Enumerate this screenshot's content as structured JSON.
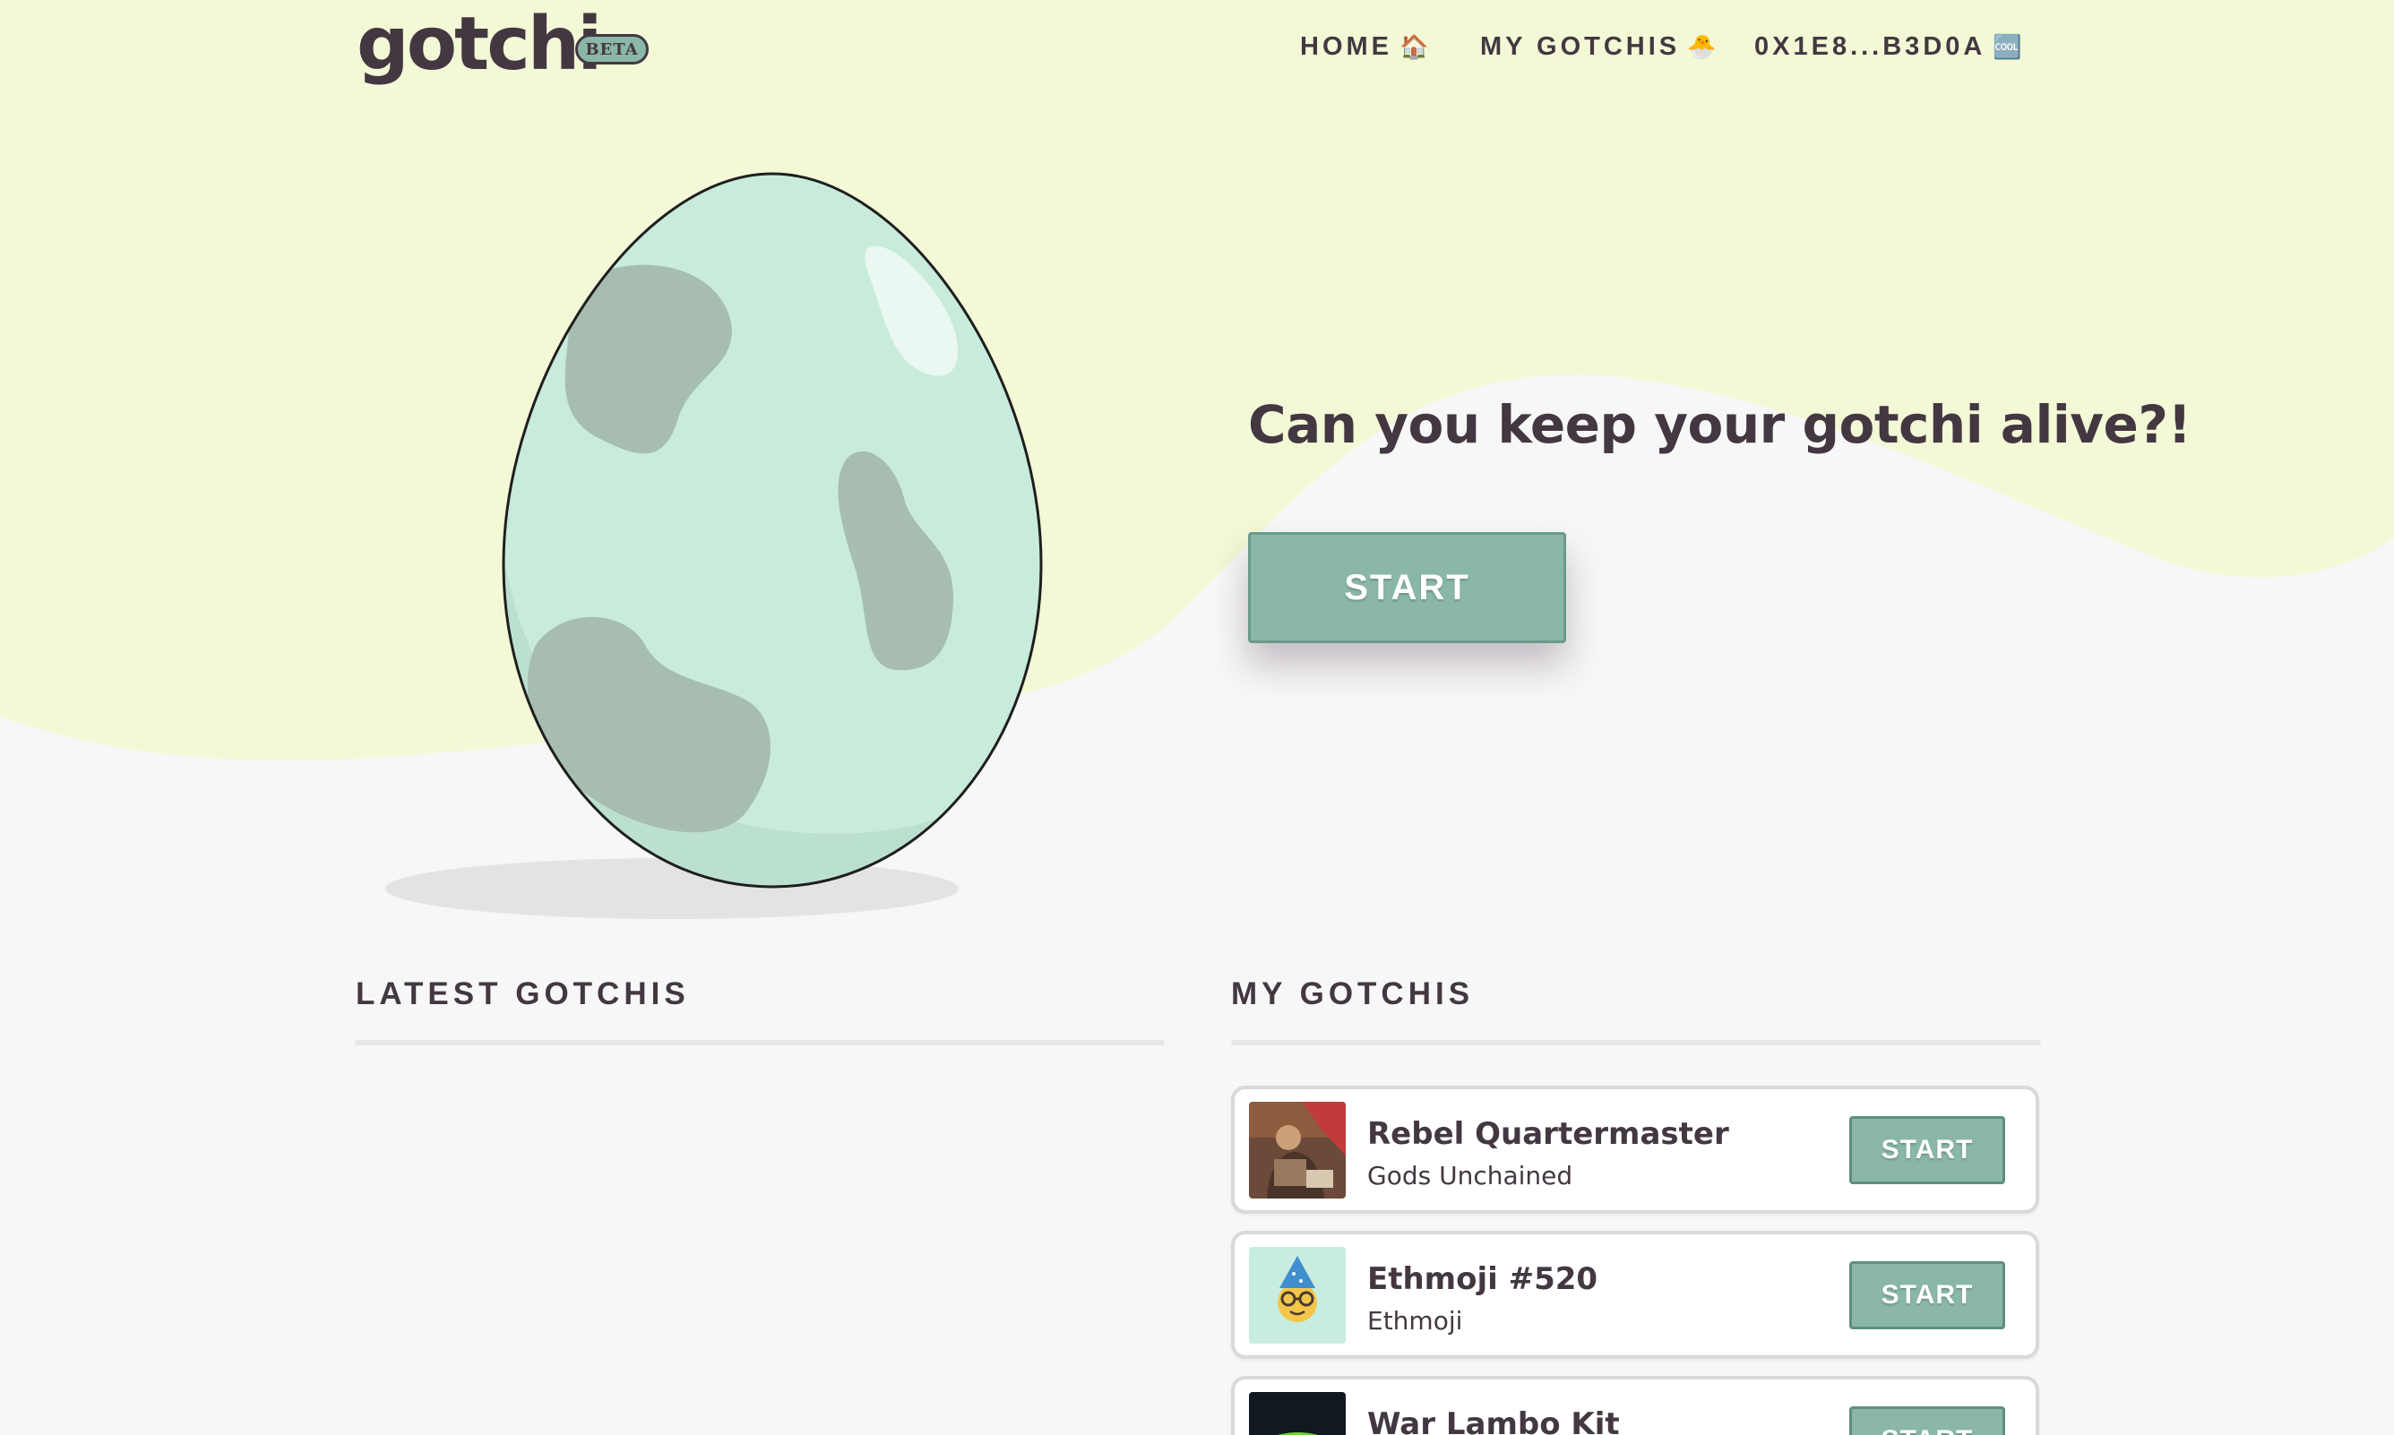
{
  "header": {
    "logo": "gotchi",
    "badge": "BETA",
    "nav": [
      {
        "label": "HOME",
        "emoji": "🏠"
      },
      {
        "label": "MY GOTCHIS",
        "emoji": "🐣"
      },
      {
        "label": "0X1E8...B3D0A",
        "emoji": "🆒"
      }
    ]
  },
  "hero": {
    "title": "Can you keep your gotchi alive?!",
    "start_label": "START"
  },
  "latest": {
    "title": "LATEST GOTCHIS"
  },
  "my_gotchis": {
    "title": "MY GOTCHIS",
    "items": [
      {
        "name": "Rebel Quartermaster",
        "collection": "Gods Unchained",
        "start_label": "START"
      },
      {
        "name": "Ethmoji #520",
        "collection": "Ethmoji",
        "start_label": "START"
      },
      {
        "name": "War Lambo Kit",
        "collection": "",
        "start_label": "START"
      }
    ]
  },
  "colors": {
    "accent": "#8ab7a7",
    "text": "#433841",
    "hero_wave": "#f3f8d6",
    "background": "#f7f7f7",
    "egg": "#c8ebdc",
    "egg_spots": "#a6bdb0"
  }
}
